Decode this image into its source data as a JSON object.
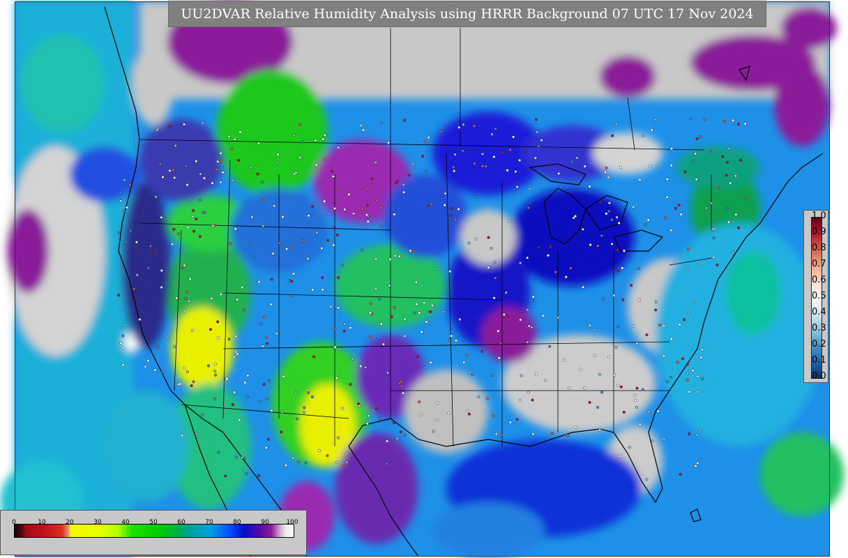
{
  "title": "UU2DVAR Relative Humidity Analysis using HRRR Background 07 UTC 17 Nov 2024",
  "qc_legend": {
    "ticks": [
      "1.0",
      "0.9",
      "0.8",
      "0.7",
      "0.6",
      "0.5",
      "0.4",
      "0.3",
      "0.2",
      "0.1",
      "0.0"
    ]
  },
  "rh_legend": {
    "ticks": [
      "0",
      "10",
      "20",
      "30",
      "40",
      "50",
      "60",
      "70",
      "80",
      "90",
      "100"
    ],
    "colors": {
      "dry": "#c41820",
      "yellow": "#f4f800",
      "green": "#00cc00",
      "cyan": "#00a0e0",
      "blue": "#0010c8",
      "purple": "#8a1a9a",
      "saturated": "#d3d3d3"
    }
  }
}
